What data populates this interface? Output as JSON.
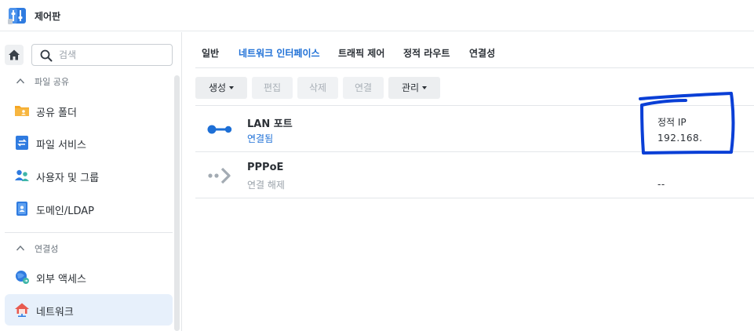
{
  "app": {
    "title": "제어판",
    "icon": "control-panel-icon"
  },
  "sidebar": {
    "home_icon": "home-icon",
    "search": {
      "placeholder": "검색",
      "value": ""
    },
    "sections": [
      {
        "label": "파일 공유",
        "expanded": true,
        "items": [
          {
            "label": "공유 폴더",
            "icon": "shared-folder-icon"
          },
          {
            "label": "파일 서비스",
            "icon": "file-services-icon"
          },
          {
            "label": "사용자 및 그룹",
            "icon": "user-group-icon"
          },
          {
            "label": "도메인/LDAP",
            "icon": "domain-ldap-icon"
          }
        ]
      },
      {
        "label": "연결성",
        "expanded": true,
        "items": [
          {
            "label": "외부 액세스",
            "icon": "external-access-icon"
          },
          {
            "label": "네트워크",
            "icon": "network-icon",
            "active": true
          }
        ]
      }
    ]
  },
  "tabs": [
    {
      "label": "일반",
      "active": false
    },
    {
      "label": "네트워크 인터페이스",
      "active": true
    },
    {
      "label": "트래픽 제어",
      "active": false
    },
    {
      "label": "정적 라우트",
      "active": false
    },
    {
      "label": "연결성",
      "active": false
    }
  ],
  "toolbar": {
    "create": "생성",
    "edit": "편집",
    "delete": "삭제",
    "connect": "연결",
    "manage": "관리"
  },
  "interfaces": [
    {
      "name": "LAN 포트",
      "status": "연결됨",
      "ip_mode": "정적 IP",
      "ip_address": "192.168.",
      "icon": "lan-connected-icon"
    },
    {
      "name": "PPPoE",
      "status": "연결 해제",
      "ip_mode": "",
      "ip_address": "--",
      "icon": "pppoe-disconnected-icon"
    }
  ],
  "colors": {
    "accent": "#1d6fd6",
    "annotation": "#0a3fd6",
    "active_nav_bg": "#e7f0fb"
  }
}
